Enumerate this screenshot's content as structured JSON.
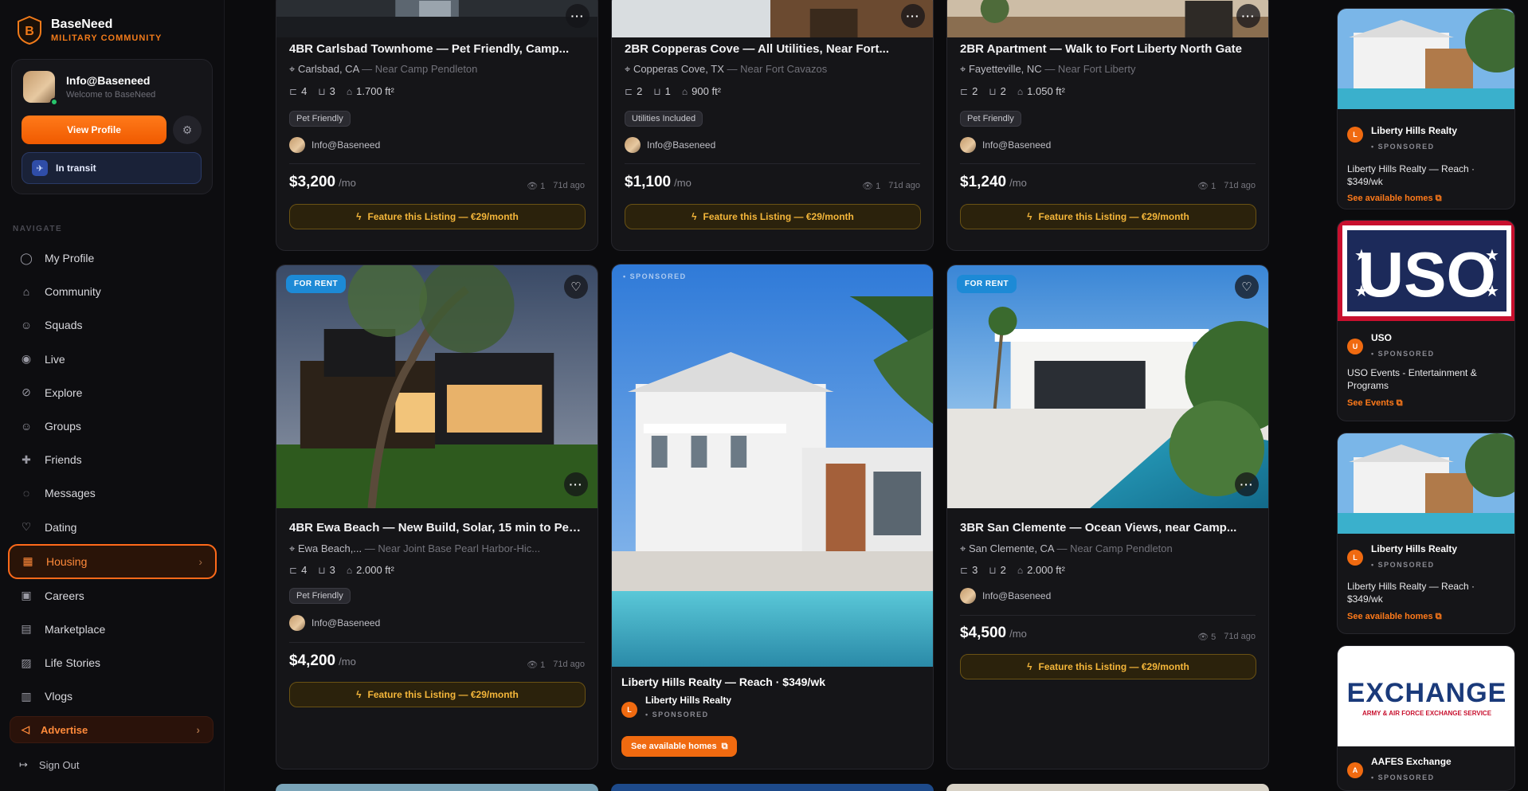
{
  "brand": {
    "name": "BaseNeed",
    "subtitle": "MILITARY COMMUNITY"
  },
  "user": {
    "name": "Info@Baseneed",
    "welcome": "Welcome to BaseNeed",
    "view_profile": "View Profile",
    "status": "In transit"
  },
  "nav": {
    "heading": "NAVIGATE",
    "items": [
      {
        "label": "My Profile",
        "icon": "user-icon"
      },
      {
        "label": "Community",
        "icon": "home-icon"
      },
      {
        "label": "Squads",
        "icon": "users-icon"
      },
      {
        "label": "Live",
        "icon": "broadcast-icon"
      },
      {
        "label": "Explore",
        "icon": "compass-icon"
      },
      {
        "label": "Groups",
        "icon": "group-icon"
      },
      {
        "label": "Friends",
        "icon": "user-plus-icon"
      },
      {
        "label": "Messages",
        "icon": "message-icon"
      },
      {
        "label": "Dating",
        "icon": "heart-icon"
      },
      {
        "label": "Housing",
        "icon": "building-icon",
        "active": true
      },
      {
        "label": "Careers",
        "icon": "briefcase-icon"
      },
      {
        "label": "Marketplace",
        "icon": "store-icon"
      },
      {
        "label": "Life Stories",
        "icon": "image-icon"
      },
      {
        "label": "Vlogs",
        "icon": "film-icon"
      }
    ],
    "advertise": "Advertise",
    "signout": "Sign Out"
  },
  "listings": [
    {
      "title": "4BR Carlsbad Townhome — Pet Friendly, Camp...",
      "city": "Carlsbad, CA",
      "near": "— Near Camp Pendleton",
      "beds": "4",
      "baths": "3",
      "area": "1.700 ft²",
      "badge": "Pet Friendly",
      "owner": "Info@Baseneed",
      "price": "$3,200",
      "per": "/mo",
      "views": "1",
      "age": "71d ago",
      "cta": "Feature this Listing — €29/month"
    },
    {
      "title": "2BR Copperas Cove — All Utilities, Near Fort...",
      "city": "Copperas Cove, TX",
      "near": "— Near Fort Cavazos",
      "beds": "2",
      "baths": "1",
      "area": "900 ft²",
      "badge": "Utilities Included",
      "owner": "Info@Baseneed",
      "price": "$1,100",
      "per": "/mo",
      "views": "1",
      "age": "71d ago",
      "cta": "Feature this Listing — €29/month"
    },
    {
      "title": "2BR Apartment — Walk to Fort Liberty North Gate",
      "city": "Fayetteville, NC",
      "near": "— Near Fort Liberty",
      "beds": "2",
      "baths": "2",
      "area": "1.050 ft²",
      "badge": "Pet Friendly",
      "owner": "Info@Baseneed",
      "price": "$1,240",
      "per": "/mo",
      "views": "1",
      "age": "71d ago",
      "cta": "Feature this Listing — €29/month"
    },
    {
      "tag": "FOR RENT",
      "title": "4BR Ewa Beach — New Build, Solar, 15 min to Pear...",
      "city": "Ewa Beach,...",
      "near": "— Near Joint Base Pearl Harbor-Hic...",
      "beds": "4",
      "baths": "3",
      "area": "2.000 ft²",
      "badge": "Pet Friendly",
      "owner": "Info@Baseneed",
      "price": "$4,200",
      "per": "/mo",
      "views": "1",
      "age": "71d ago",
      "cta": "Feature this Listing — €29/month"
    },
    {
      "tag": "FOR RENT",
      "title": "3BR San Clemente — Ocean Views, near Camp...",
      "city": "San Clemente, CA",
      "near": "— Near Camp Pendleton",
      "beds": "3",
      "baths": "2",
      "area": "2.000 ft²",
      "owner": "Info@Baseneed",
      "price": "$4,500",
      "per": "/mo",
      "views": "5",
      "age": "71d ago",
      "cta": "Feature this Listing — €29/month"
    }
  ],
  "sponsored_card": {
    "tag": "• SPONSORED",
    "title": "Liberty Hills Realty — Reach · $349/wk",
    "brand": "Liberty Hills Realty",
    "initial": "L",
    "label": "• SPONSORED",
    "cta": "See available homes"
  },
  "ads": [
    {
      "brand": "Liberty Hills Realty",
      "initial": "L",
      "label": "• SPONSORED",
      "text": "Liberty Hills Realty — Reach · $349/wk",
      "link": "See available homes"
    },
    {
      "brand": "USO",
      "initial": "U",
      "label": "• SPONSORED",
      "text": "USO Events - Entertainment & Programs",
      "link": "See Events",
      "logo": "USO"
    },
    {
      "brand": "Liberty Hills Realty",
      "initial": "L",
      "label": "• SPONSORED",
      "text": "Liberty Hills Realty — Reach · $349/wk",
      "link": "See available homes"
    },
    {
      "brand": "AAFES Exchange",
      "initial": "A",
      "label": "• SPONSORED",
      "logo": "EXCHANGE",
      "logo_sub": "ARMY & AIR FORCE EXCHANGE SERVICE"
    }
  ],
  "colors": {
    "accent": "#f06a10",
    "gold": "#f4b63a",
    "rent_tag": "#1d8ad6"
  }
}
